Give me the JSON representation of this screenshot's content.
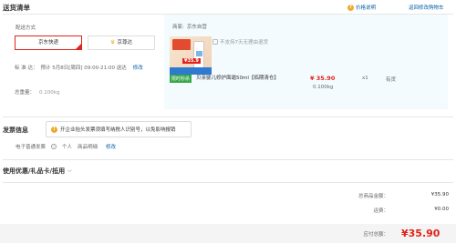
{
  "header": {
    "title": "送货清单",
    "price_info_link": "价格说明",
    "back_to_cart_link": "返回修改购物车"
  },
  "shipping": {
    "label": "配送方式",
    "options": [
      {
        "label": "京东快递",
        "selected": true
      },
      {
        "label": "京尊达",
        "selected": false
      }
    ],
    "time_label": "标 准 达：",
    "time_value": "预计 5月8日[周四] 09:00-21:00 送达",
    "time_edit": "修改",
    "weight_label": "总重量：",
    "weight_value": "0.100kg"
  },
  "product": {
    "seller_label": "商家:",
    "seller_name": "京东自营",
    "no_7day_notice": "不支持7天无理由退货",
    "badge": "限时秒杀",
    "name": "贝亲婴儿修护面霜50ml【临期清仓】",
    "price": "¥ 35.90",
    "weight": "0.100kg",
    "qty": "x1",
    "stock": "有货",
    "image_price_tag": "¥35.9"
  },
  "invoice": {
    "title": "发票信息",
    "tip": "开企业抬头发票须填写纳税人识别号，以免影响报销",
    "type": "电子普通发票",
    "holder": "个人",
    "content": "商品明细",
    "edit": "修改"
  },
  "coupon": {
    "title": "使用优惠/礼品卡/抵用"
  },
  "summary": {
    "total_label": "总商品金额：",
    "total_value": "¥35.90",
    "freight_label": "运费：",
    "freight_value": "¥0.00",
    "payable_label": "应付总额：",
    "payable_value": "¥35.90"
  },
  "colors": {
    "accent_red": "#e2231a",
    "link_blue": "#005ea7",
    "panel_blue": "#f3fbfe",
    "badge_green": "#3aa84d"
  }
}
